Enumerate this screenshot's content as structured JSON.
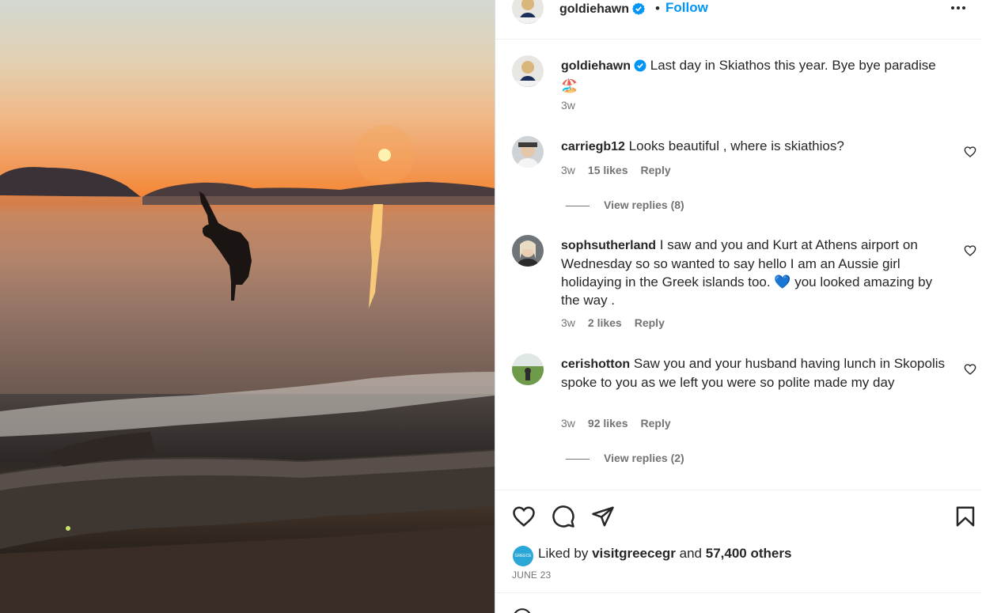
{
  "post": {
    "author": "goldiehawn",
    "follow_label": "Follow",
    "separator": "•",
    "caption": "Last day in Skiathos this year. Bye bye paradise",
    "caption_emoji": "🏖️",
    "caption_time": "3w",
    "likes_prefix": "Liked by",
    "liked_by_user": "visitgreecegr",
    "likes_and": "and",
    "likes_others": "57,400 others",
    "liked_by_avatar_text": "GREECE",
    "date": "JUNE 23"
  },
  "comments": [
    {
      "user": "carriegb12",
      "text": "Looks beautiful , where is skiathios?",
      "time": "3w",
      "likes": "15 likes",
      "reply": "Reply",
      "view_replies": "View replies (8)"
    },
    {
      "user": "sophsutherland",
      "text": "I saw and you and Kurt at Athens airport on Wednesday so so wanted to say hello I am an Aussie girl holidaying in the Greek islands too. 💙 you looked amazing by the way .",
      "time": "3w",
      "likes": "2 likes",
      "reply": "Reply"
    },
    {
      "user": "cerishotton",
      "text": "Saw you and your husband having lunch in Skopolis spoke to you as we left you were so polite made my day",
      "time": "3w",
      "likes": "92 likes",
      "reply": "Reply",
      "view_replies": "View replies (2)"
    }
  ],
  "icons": {
    "more": "more-options-icon",
    "verified": "verified-badge-icon",
    "like": "heart-icon",
    "comment": "comment-icon",
    "share": "share-icon",
    "save": "bookmark-icon"
  },
  "colors": {
    "accent": "#0095f6",
    "verified": "#0095f6",
    "secondary_text": "#737373"
  }
}
